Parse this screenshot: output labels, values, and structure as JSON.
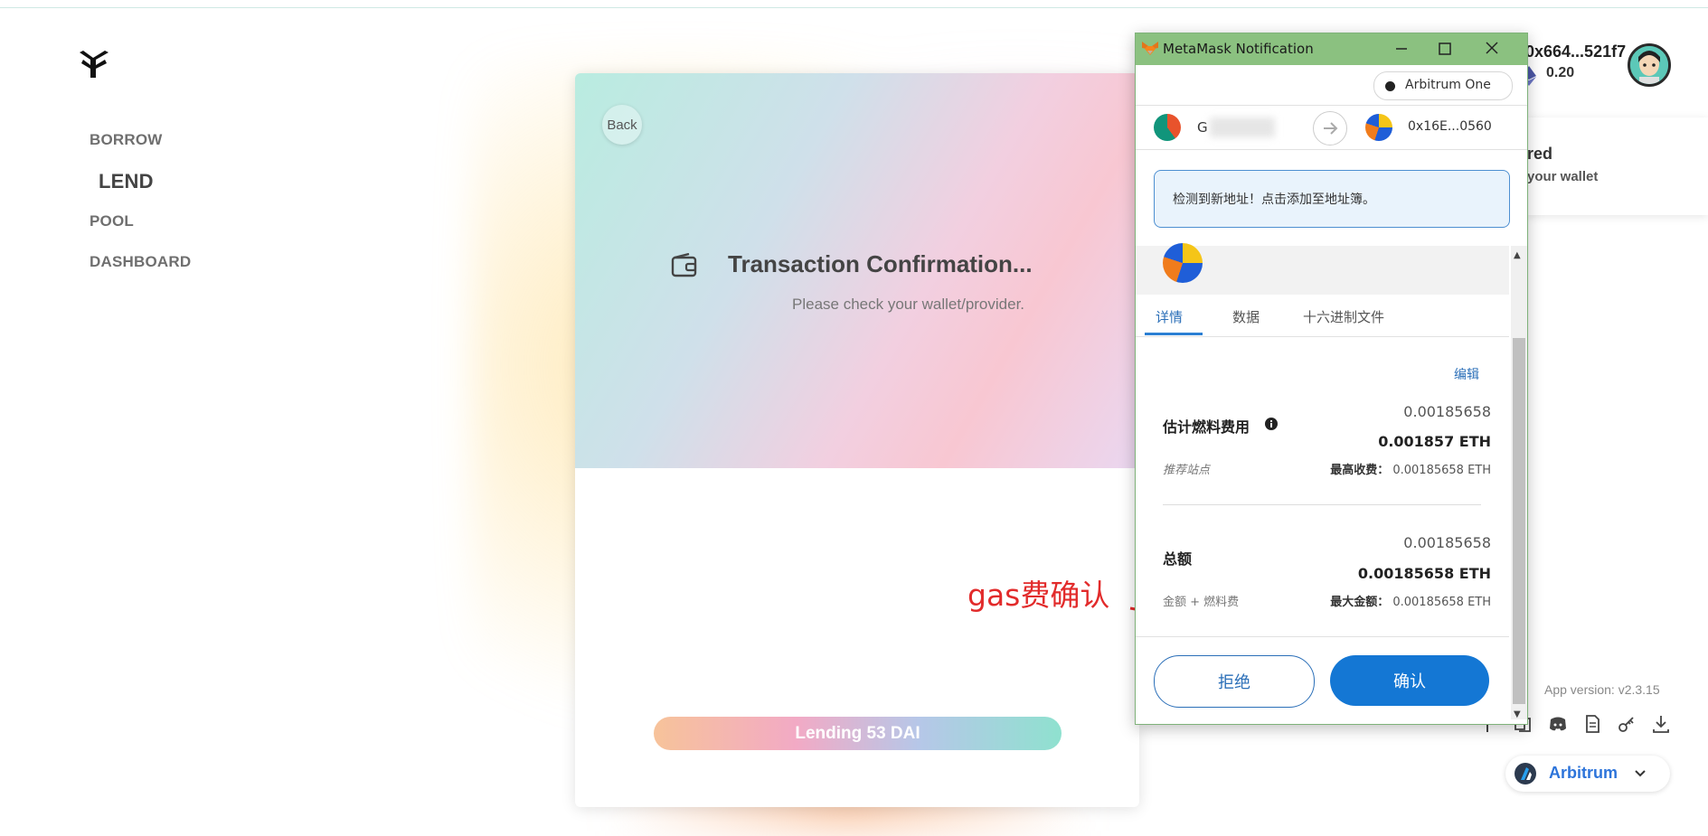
{
  "nav": {
    "items": [
      {
        "label": "BORROW"
      },
      {
        "label": "LEND"
      },
      {
        "label": "POOL"
      },
      {
        "label": "DASHBOARD"
      }
    ]
  },
  "modal": {
    "back_label": "Back",
    "title": "Transaction Confirmation...",
    "subtitle": "Please check your wallet/provider.",
    "lend_button": "Lending 53 DAI"
  },
  "annotation": {
    "text": "gas费确认",
    "color": "#e22b2b"
  },
  "header": {
    "account": "0x664...521f7",
    "balance": "0.20"
  },
  "notice_card": {
    "line1": "red",
    "line2": "your wallet"
  },
  "footer": {
    "app_version": "App version: v2.3.15",
    "network_label": "Arbitrum"
  },
  "metamask": {
    "window_title": "MetaMask Notification",
    "network": "Arbitrum One",
    "from_account": "G",
    "to_account": "0x16E...0560",
    "alert": "检测到新地址！点击添加至地址簿。",
    "tabs": [
      {
        "label": "详情"
      },
      {
        "label": "数据"
      },
      {
        "label": "十六进制文件"
      }
    ],
    "edit_label": "编辑",
    "gas": {
      "label": "估计燃料费用",
      "value": "0.00185658",
      "value_bold": "0.001857 ETH",
      "site_label": "推荐站点",
      "max_label": "最高收费：",
      "max_value": "0.00185658 ETH"
    },
    "total": {
      "label": "总额",
      "value": "0.00185658",
      "value_bold": "0.00185658 ETH",
      "sub_label": "金额 + 燃料费",
      "max_label": "最大金额：",
      "max_value": "0.00185658 ETH"
    },
    "reject_label": "拒绝",
    "confirm_label": "确认",
    "colors": {
      "titlebar": "#8bc180",
      "primary": "#1477d4"
    }
  }
}
